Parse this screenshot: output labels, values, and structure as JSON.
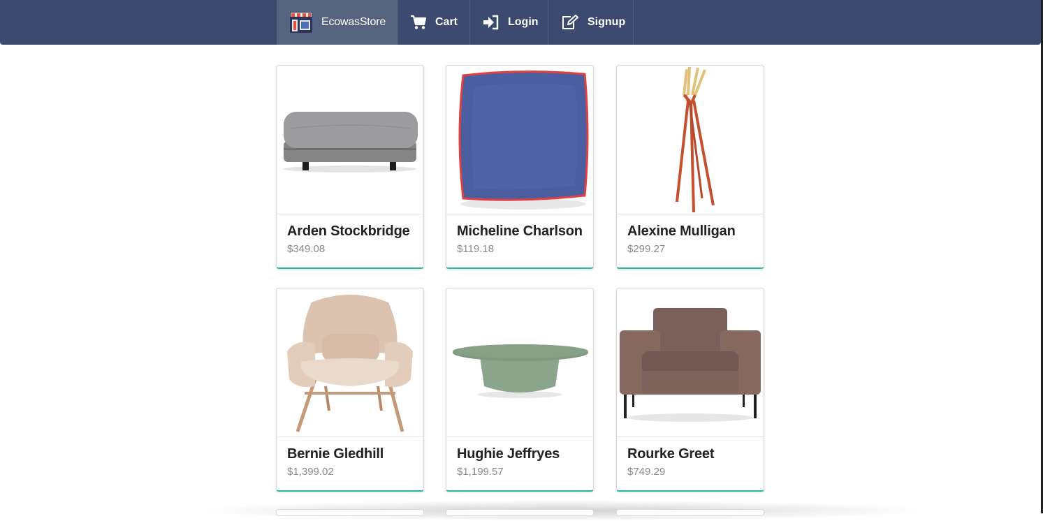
{
  "nav": {
    "brand": "EcowasStore",
    "cart": "Cart",
    "login": "Login",
    "signup": "Signup"
  },
  "products": [
    {
      "name": "Arden Stockbridge",
      "price": "$349.08",
      "image": "ottoman"
    },
    {
      "name": "Micheline Charlson",
      "price": "$119.18",
      "image": "pillow"
    },
    {
      "name": "Alexine Mulligan",
      "price": "$299.27",
      "image": "coat-rack"
    },
    {
      "name": "Bernie Gledhill",
      "price": "$1,399.02",
      "image": "lounge-chair"
    },
    {
      "name": "Hughie Jeffryes",
      "price": "$1,199.57",
      "image": "coffee-table"
    },
    {
      "name": "Rourke Greet",
      "price": "$749.29",
      "image": "armchair"
    }
  ],
  "colors": {
    "navbar": "#3c4a6f",
    "brand_bg": "#56637f",
    "card_accent": "#21ba9c"
  }
}
